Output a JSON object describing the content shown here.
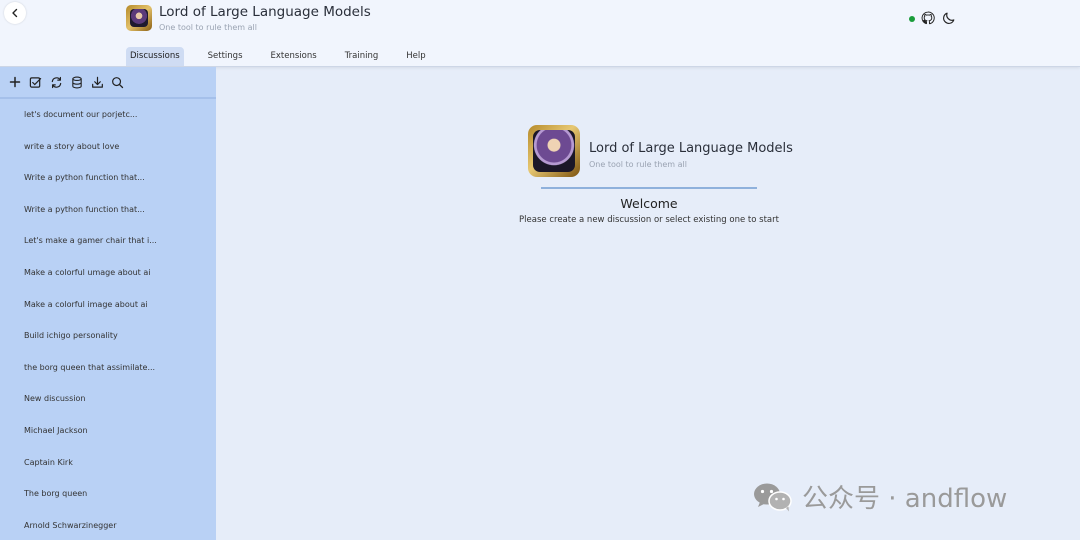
{
  "header": {
    "app_title": "Lord of Large Language Models",
    "app_subtitle": "One tool to rule them all",
    "tabs": [
      {
        "label": "Discussions",
        "active": true
      },
      {
        "label": "Settings"
      },
      {
        "label": "Extensions"
      },
      {
        "label": "Training"
      },
      {
        "label": "Help"
      }
    ],
    "status": "connected",
    "icons": [
      "back-arrow-icon",
      "github-icon",
      "moon-icon"
    ],
    "status_color": "#1a9c3a"
  },
  "sidebar": {
    "toolbar_icons": [
      "plus-icon",
      "check-square-icon",
      "refresh-icon",
      "database-icon",
      "download-icon",
      "search-icon"
    ],
    "discussions": [
      "let's document our porjetc...",
      "write a story about love",
      "Write a python function that...",
      "Write a python function that...",
      "Let's make a gamer chair that i...",
      "Make a colorful umage about ai",
      "Make a colorful image about ai",
      "Build ichigo personality",
      "the borg queen that assimilate...",
      "New discussion",
      "Michael Jackson",
      "Captain Kirk",
      "The borg queen",
      "Arnold Schwarzinegger"
    ]
  },
  "main": {
    "app_title": "Lord of Large Language Models",
    "app_subtitle": "One tool to rule them all",
    "heading": "Welcome",
    "text": "Please create a new discussion or select existing one to start"
  },
  "watermark": {
    "text": "公众号 · andflow"
  },
  "colors": {
    "sidebar_bg": "#b9d1f5",
    "main_bg": "#e6edf9",
    "header_bg": "#f1f5fd",
    "active_tab_bg": "#cfdcf3"
  }
}
